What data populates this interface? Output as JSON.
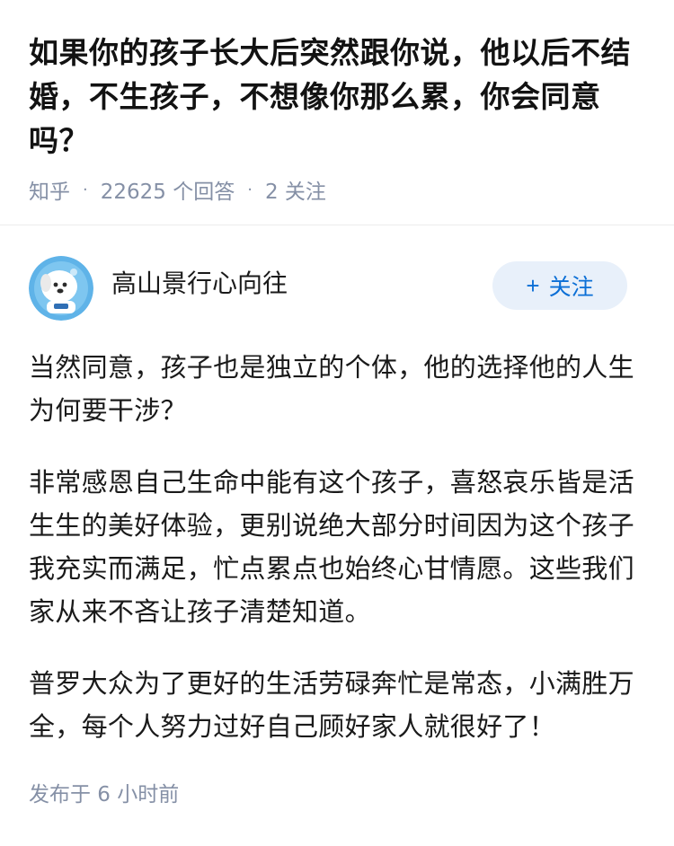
{
  "question": {
    "title": "如果你的孩子长大后突然跟你说，他以后不结婚，不生孩子，不想像你那么累，你会同意吗？",
    "source": "知乎",
    "answers_count": "22625 个回答",
    "follow_count": "2 关注",
    "separator": "·"
  },
  "answer": {
    "author": "高山景行心向往",
    "follow_label": "关注",
    "follow_plus": "+",
    "paragraphs": [
      "当然同意，孩子也是独立的个体，他的选择他的人生为何要干涉？",
      "非常感恩自己生命中能有这个孩子，喜怒哀乐皆是活生生的美好体验，更别说绝大部分时间因为这个孩子我充实而满足，忙点累点也始终心甘情愿。这些我们家从来不吝让孩子清楚知道。",
      "普罗大众为了更好的生活劳碌奔忙是常态，小满胜万全，每个人努力过好自己顾好家人就很好了！"
    ],
    "published": "发布于 6 小时前"
  },
  "colors": {
    "meta_gray": "#8590a6",
    "follow_blue": "#0b6fd6",
    "follow_bg": "#e8f0fa"
  },
  "icons": {
    "avatar": "cartoon-dog-astronaut-avatar"
  }
}
